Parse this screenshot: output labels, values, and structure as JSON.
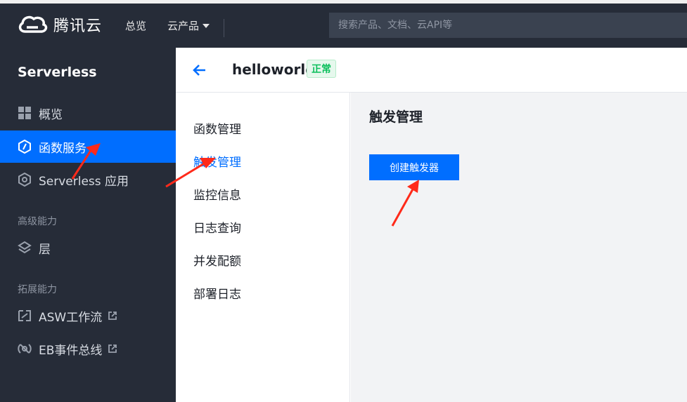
{
  "topbar": {
    "brand": "腾讯云",
    "nav_overview": "总览",
    "nav_products": "云产品",
    "search_placeholder": "搜索产品、文档、云API等"
  },
  "sidebar": {
    "title": "Serverless",
    "items": [
      {
        "label": "概览",
        "icon": "grid-icon"
      },
      {
        "label": "函数服务",
        "icon": "function-icon",
        "active": true
      },
      {
        "label": "Serverless 应用",
        "icon": "app-icon"
      }
    ],
    "group_advanced": "高级能力",
    "advanced_items": [
      {
        "label": "层",
        "icon": "layers-icon"
      }
    ],
    "group_extension": "拓展能力",
    "extension_items": [
      {
        "label": "ASW工作流",
        "icon": "workflow-icon"
      },
      {
        "label": "EB事件总线",
        "icon": "eventbus-icon"
      }
    ]
  },
  "header": {
    "function_name": "helloworld",
    "status": "正常"
  },
  "submenu": {
    "items": [
      "函数管理",
      "触发管理",
      "监控信息",
      "日志查询",
      "并发配额",
      "部署日志"
    ]
  },
  "content": {
    "title": "触发管理",
    "create_button": "创建触发器"
  },
  "colors": {
    "nav_bg": "#262c38",
    "accent": "#006eff",
    "status_green": "#0abf5b",
    "annotation_red": "#ff2a1a"
  }
}
